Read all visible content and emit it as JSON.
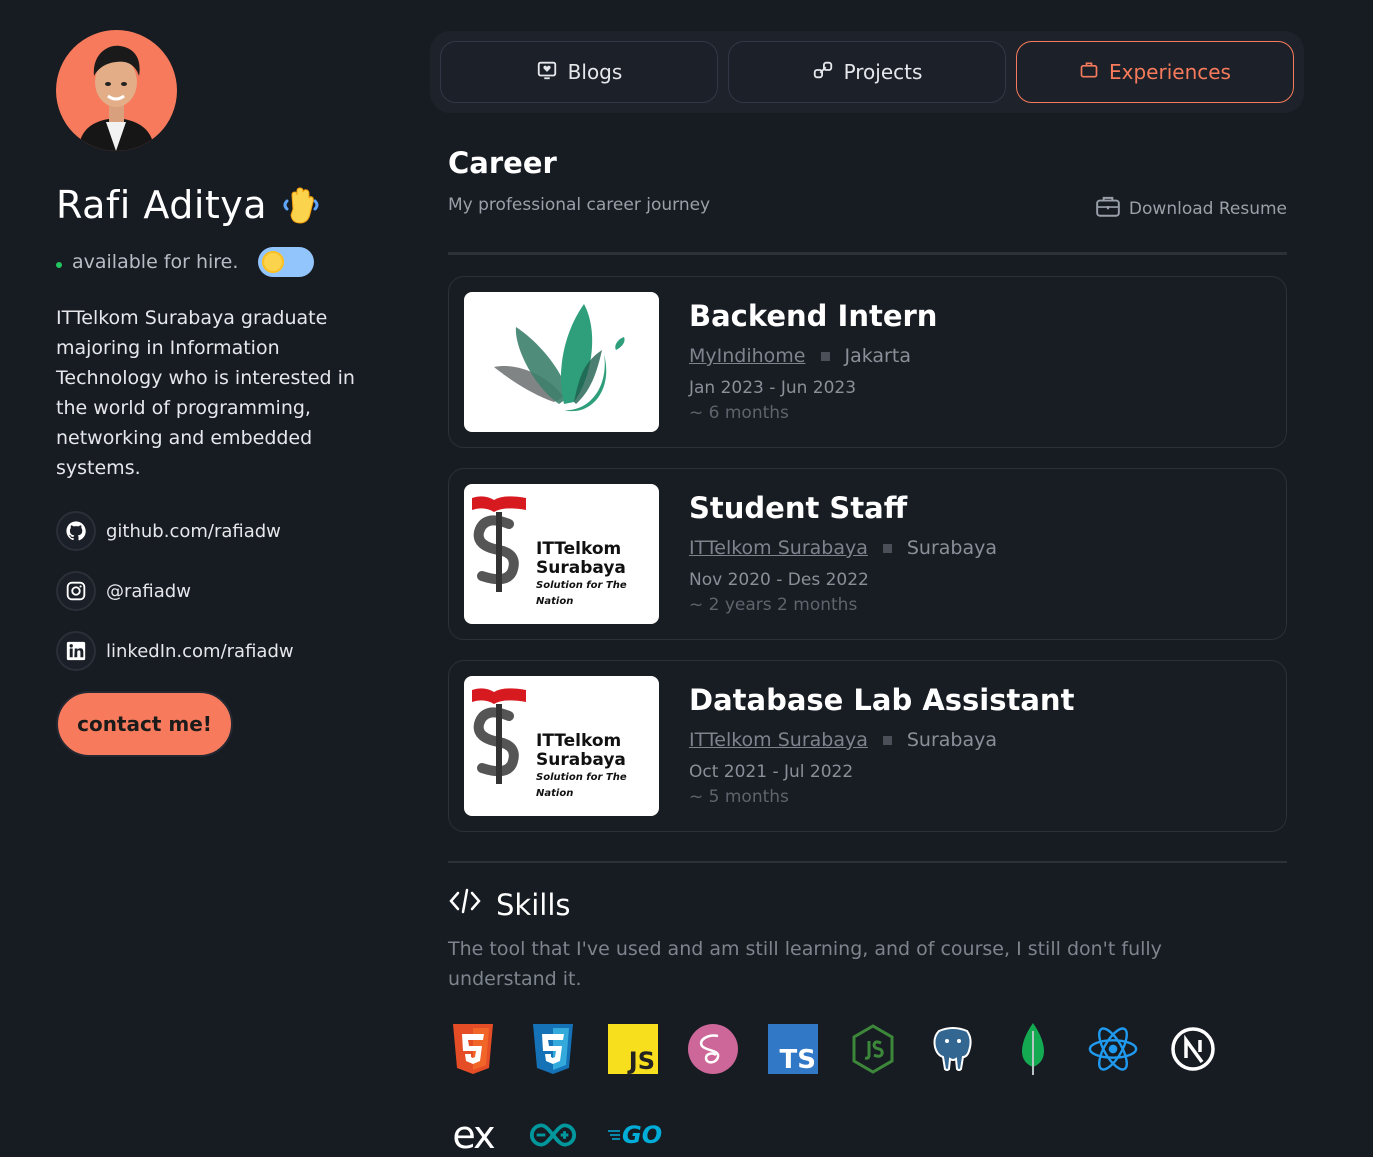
{
  "profile": {
    "name": "Rafi Aditya",
    "status": "available for hire.",
    "bio": "ITTelkom Surabaya graduate majoring in Information Technology who is interested in the world of programming, networking and embedded systems.",
    "socials": [
      {
        "icon": "github-icon",
        "label": "github.com/rafiadw"
      },
      {
        "icon": "instagram-icon",
        "label": "@rafiadw"
      },
      {
        "icon": "linkedin-icon",
        "label": "linkedIn.com/rafiadw"
      }
    ],
    "contact_label": "contact me!"
  },
  "tabs": [
    {
      "icon": "blog-icon",
      "label": "Blogs",
      "active": false
    },
    {
      "icon": "link-icon",
      "label": "Projects",
      "active": false
    },
    {
      "icon": "briefcase-icon",
      "label": "Experiences",
      "active": true
    }
  ],
  "career": {
    "title": "Career",
    "subtitle": "My professional career journey",
    "download_label": "Download Resume",
    "items": [
      {
        "role": "Backend Intern",
        "company": "MyIndihome",
        "city": "Jakarta",
        "dates": "Jan 2023 - Jun 2023",
        "duration": "~ 6 months"
      },
      {
        "role": "Student Staff",
        "company": "ITTelkom Surabaya",
        "city": "Surabaya",
        "dates": "Nov 2020 - Des 2022",
        "duration": "~ 2 years 2 months"
      },
      {
        "role": "Database Lab Assistant",
        "company": "ITTelkom Surabaya",
        "city": "Surabaya",
        "dates": "Oct 2021 - Jul 2022",
        "duration": "~ 5 months"
      }
    ]
  },
  "logos": {
    "ittelkom_line1": "ITTelkom",
    "ittelkom_line2": "Surabaya",
    "ittelkom_tagline": "Solution for The Nation"
  },
  "skills": {
    "title": "Skills",
    "subtitle": "The tool that I've used and am still learning, and of course, I still don't fully understand it.",
    "icons": [
      "html5-icon",
      "css3-icon",
      "javascript-icon",
      "sass-icon",
      "typescript-icon",
      "nodejs-icon",
      "postgresql-icon",
      "mongodb-icon",
      "react-icon",
      "nextjs-icon",
      "express-icon",
      "arduino-icon",
      "go-icon"
    ],
    "icon_text": {
      "js": "JS",
      "ts": "TS",
      "go": "GO",
      "ex": "ex"
    }
  },
  "colors": {
    "accent": "#f67a5b",
    "background": "#171b22",
    "status": "#22c55e"
  }
}
